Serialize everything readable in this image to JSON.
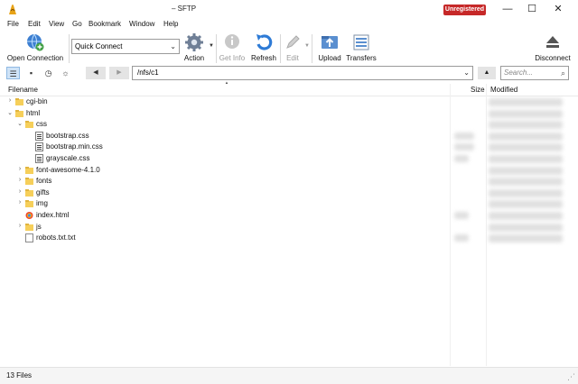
{
  "window": {
    "title": "– SFTP",
    "badge": "Unregistered",
    "badge_color": "#c62828",
    "controls": {
      "minimize": "—",
      "maximize": "☐",
      "close": "✕"
    }
  },
  "menu": [
    "File",
    "Edit",
    "View",
    "Go",
    "Bookmark",
    "Window",
    "Help"
  ],
  "toolbar": {
    "open_connection": "Open Connection",
    "quick_connect": "Quick Connect",
    "action": "Action",
    "get_info": "Get Info",
    "refresh": "Refresh",
    "edit": "Edit",
    "upload": "Upload",
    "transfers": "Transfers",
    "disconnect": "Disconnect"
  },
  "navbar": {
    "path": "/nfs/c1",
    "search_placeholder": "Search...",
    "back": "◀",
    "forward": "▶",
    "up": "▲"
  },
  "columns": {
    "filename": "Filename",
    "size": "Size",
    "modified": "Modified"
  },
  "files": [
    {
      "name": "cgi-bin",
      "type": "folder",
      "level": 0,
      "toggle": "›"
    },
    {
      "name": "html",
      "type": "folder",
      "level": 0,
      "toggle": "⌄"
    },
    {
      "name": "css",
      "type": "folder",
      "level": 1,
      "toggle": "⌄"
    },
    {
      "name": "bootstrap.css",
      "type": "css-file",
      "level": 2,
      "toggle": ""
    },
    {
      "name": "bootstrap.min.css",
      "type": "css-file",
      "level": 2,
      "toggle": ""
    },
    {
      "name": "grayscale.css",
      "type": "css-file",
      "level": 2,
      "toggle": ""
    },
    {
      "name": "font-awesome-4.1.0",
      "type": "folder",
      "level": 1,
      "toggle": "›"
    },
    {
      "name": "fonts",
      "type": "folder",
      "level": 1,
      "toggle": "›"
    },
    {
      "name": "gifts",
      "type": "folder",
      "level": 1,
      "toggle": "›"
    },
    {
      "name": "img",
      "type": "folder",
      "level": 1,
      "toggle": "›"
    },
    {
      "name": "index.html",
      "type": "html-file",
      "level": 1,
      "toggle": ""
    },
    {
      "name": "js",
      "type": "folder",
      "level": 1,
      "toggle": "›"
    },
    {
      "name": "robots.txt.txt",
      "type": "text-file",
      "level": 1,
      "toggle": ""
    }
  ],
  "status": {
    "file_count": "13 Files"
  },
  "colors": {
    "accent": "#2e7bd6",
    "folder": "#f6cf5a",
    "selection": "#cfe3f7"
  }
}
